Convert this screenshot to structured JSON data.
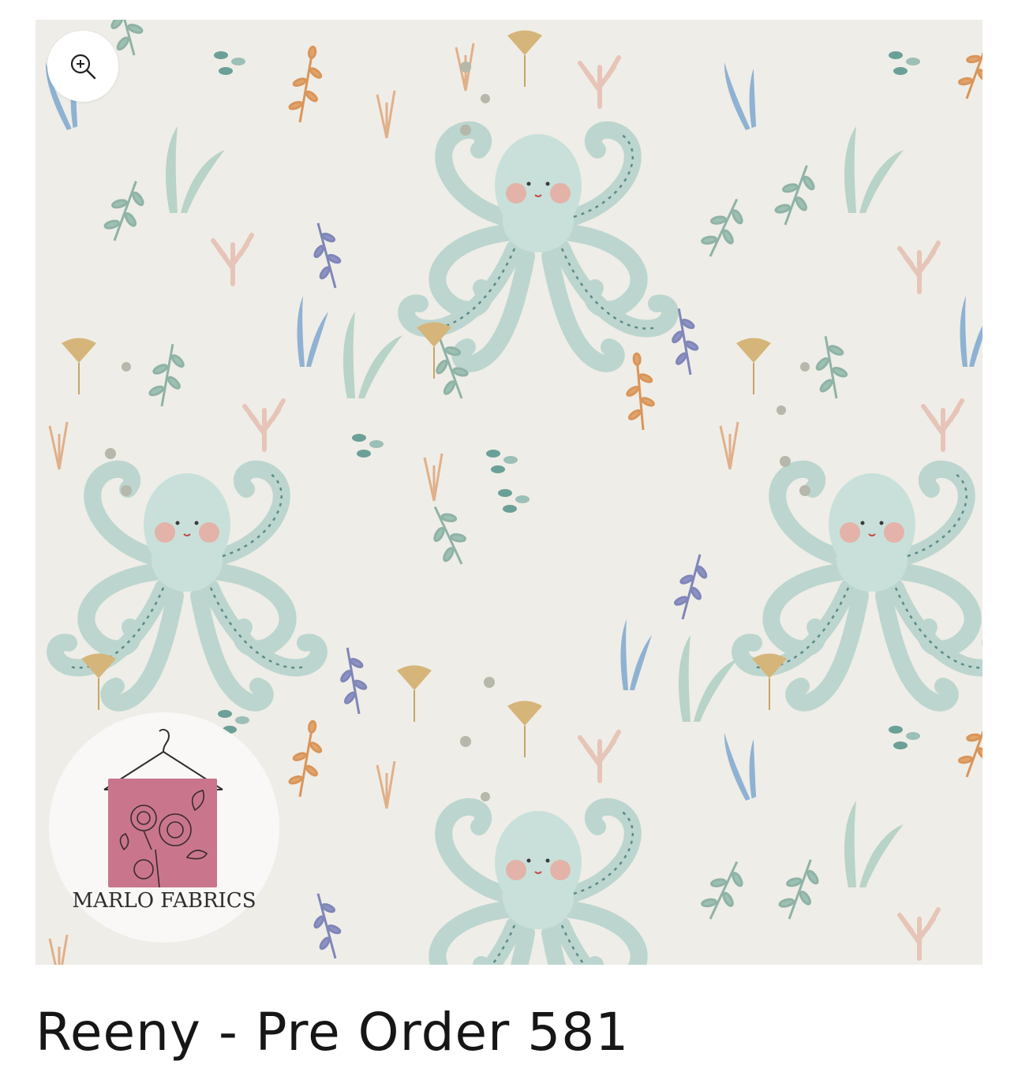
{
  "product": {
    "title": "Reeny - Pre Order 581"
  },
  "image": {
    "zoom_icon": "zoom-in-icon",
    "logo_text": "MARLO FABRICS",
    "background_color": "#efede7",
    "octopus_color": "#c5dcd6",
    "logo_swatch_color": "#c9768d"
  }
}
